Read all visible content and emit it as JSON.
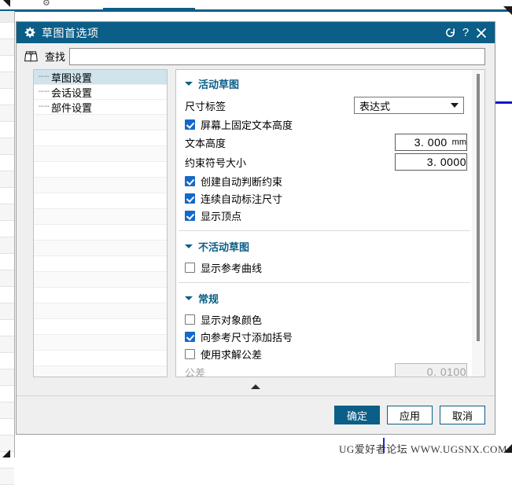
{
  "background": {
    "tab_strip_accent": "#0b5e87",
    "rule_color": "#1414d2"
  },
  "dialog": {
    "title": "草图首选项",
    "title_icon": "gear-icon",
    "titlebar_color": "#0b5e87",
    "buttons": {
      "reset_icon": "reset-refresh-icon",
      "help_label": "?",
      "close_icon": "close-icon"
    },
    "find": {
      "icon": "binoculars-icon",
      "label": "查找",
      "value": "",
      "placeholder": ""
    },
    "tree": {
      "items": [
        {
          "label": "草图设置",
          "selected": true
        },
        {
          "label": "会话设置",
          "selected": false
        },
        {
          "label": "部件设置",
          "selected": false
        }
      ]
    },
    "groups": [
      {
        "title": "活动草图",
        "expanded": true,
        "rows": [
          {
            "kind": "combo",
            "label": "尺寸标签",
            "value": "表达式"
          },
          {
            "kind": "check",
            "label": "屏幕上固定文本高度",
            "checked": true
          },
          {
            "kind": "number",
            "label": "文本高度",
            "value": "3. 000",
            "unit": "mm",
            "disabled": false
          },
          {
            "kind": "number",
            "label": "约束符号大小",
            "value": "3. 0000",
            "unit": "",
            "disabled": false
          },
          {
            "kind": "check",
            "label": "创建自动判断约束",
            "checked": true
          },
          {
            "kind": "check",
            "label": "连续自动标注尺寸",
            "checked": true
          },
          {
            "kind": "check",
            "label": "显示顶点",
            "checked": true
          }
        ]
      },
      {
        "title": "不活动草图",
        "expanded": true,
        "rows": [
          {
            "kind": "check",
            "label": "显示参考曲线",
            "checked": false
          }
        ]
      },
      {
        "title": "常规",
        "expanded": true,
        "rows": [
          {
            "kind": "check",
            "label": "显示对象颜色",
            "checked": false
          },
          {
            "kind": "check",
            "label": "向参考尺寸添加括号",
            "checked": true
          },
          {
            "kind": "check",
            "label": "使用求解公差",
            "checked": false
          },
          {
            "kind": "number",
            "label": "公差",
            "value": "0. 0100",
            "unit": "",
            "disabled": true
          }
        ]
      }
    ],
    "collapse_icon": "chevron-up-icon",
    "footer": {
      "ok_label": "确定",
      "apply_label": "应用",
      "cancel_label": "取消",
      "primary_color": "#0b5e87"
    }
  },
  "watermark": "UG爱好者论坛 WWW.UGSNX.COM"
}
